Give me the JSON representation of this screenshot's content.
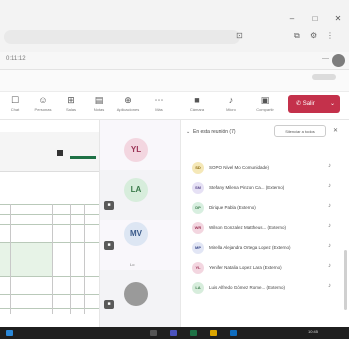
{
  "window_controls": [
    "–",
    "□",
    "✕"
  ],
  "tab": {
    "label": "0:11:12"
  },
  "toolbar": {
    "items": [
      {
        "label": "Chat",
        "icon": "chat-icon"
      },
      {
        "label": "Personas",
        "icon": "people-icon"
      },
      {
        "label": "Salas",
        "icon": "rooms-icon"
      },
      {
        "label": "Notas",
        "icon": "notes-icon"
      },
      {
        "label": "Aplicaciones",
        "icon": "apps-icon"
      },
      {
        "label": "Más",
        "icon": "more-icon"
      },
      {
        "label": "Cámara",
        "icon": "camera-icon"
      },
      {
        "label": "Micro",
        "icon": "mic-icon"
      },
      {
        "label": "Compartir",
        "icon": "share-icon"
      }
    ],
    "leave_label": "Salir"
  },
  "video_tiles": [
    {
      "initials": "YL",
      "bg": "#f3d6e0",
      "fg": "#9b3355"
    },
    {
      "initials": "LA",
      "bg": "#d7eddc",
      "fg": "#3a7a4a"
    },
    {
      "initials": "MV",
      "bg": "#dde6f3",
      "fg": "#3a5a8a"
    }
  ],
  "video_label": "Lo",
  "participants": {
    "header": "En esta reunión (7)",
    "admit_all": "Silenciar a todos",
    "list": [
      {
        "initials": "SD",
        "name": "SOPO Nivel Mo Comunidade)",
        "bg": "#f5e8b8",
        "fg": "#8a6a10"
      },
      {
        "initials": "SM",
        "name": "Stefany Milena Pinzon Ca... (Externo)",
        "bg": "#e6e1f5",
        "fg": "#5a4a8a"
      },
      {
        "initials": "DP",
        "name": "Dirique Pabla (Externo)",
        "bg": "#d8efe0",
        "fg": "#3a7a4a"
      },
      {
        "initials": "WR",
        "name": "Wilson Gonzalez Mattheus... (Externo)",
        "bg": "#f3d6e0",
        "fg": "#9b3355"
      },
      {
        "initials": "MP",
        "name": "Mirella Alejandra Ortega Lopez (Externo)",
        "bg": "#e2e6f5",
        "fg": "#3a4a8a"
      },
      {
        "initials": "YL",
        "name": "Yenifer Natalia Lopez Lara (Externo)",
        "bg": "#f3d6e0",
        "fg": "#9b3355"
      },
      {
        "initials": "LA",
        "name": "Luis Alfredo Gómez Rome... (Externo)",
        "bg": "#d7eddc",
        "fg": "#3a7a4a"
      }
    ]
  },
  "clock": "10:45"
}
